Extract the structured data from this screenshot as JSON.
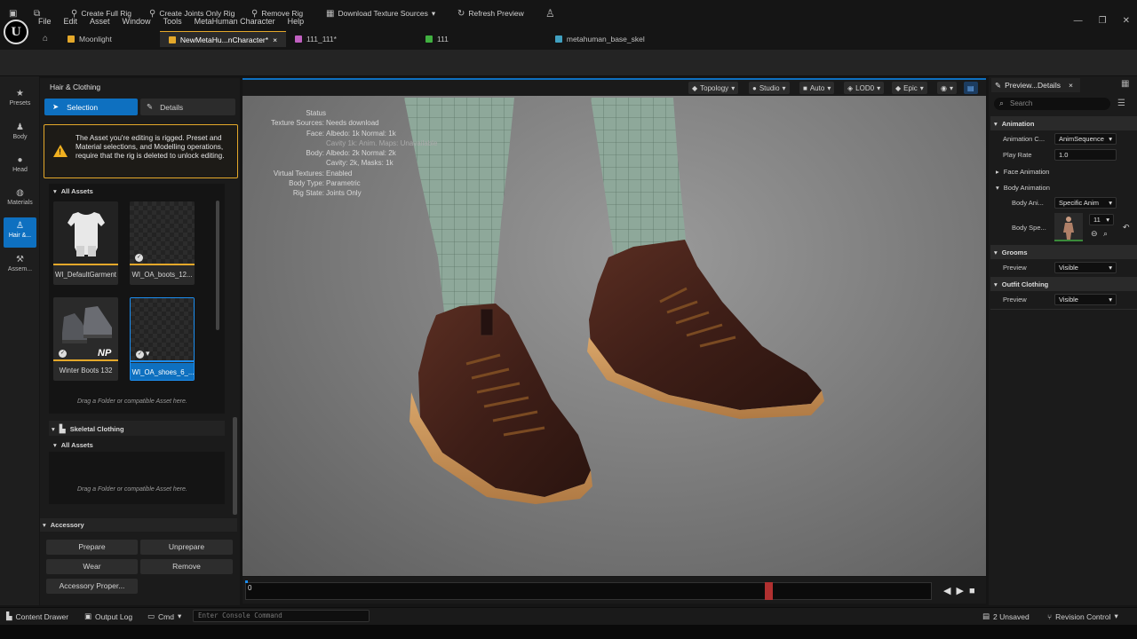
{
  "app": {
    "logo_text": "U",
    "menu": [
      "File",
      "Edit",
      "Asset",
      "Window",
      "Tools",
      "MetaHuman Character",
      "Help"
    ],
    "tabs": [
      {
        "label": "Moonlight",
        "icon": "level-icon",
        "color": "#e4a82a",
        "active": false
      },
      {
        "label": "NewMetaHu...nCharacter*",
        "icon": "character-icon",
        "color": "#e4a82a",
        "active": true
      },
      {
        "label": "111_111*",
        "icon": "skeleton-icon",
        "color": "#c060c0",
        "active": false
      },
      {
        "label": "111",
        "icon": "anim-icon",
        "color": "#40b040",
        "active": false
      },
      {
        "label": "metahuman_base_skel",
        "icon": "skeleton-icon",
        "color": "#40a0c0",
        "active": false
      }
    ]
  },
  "toolbar": {
    "create_full_rig": "Create Full Rig",
    "create_joints_only_rig": "Create Joints Only Rig",
    "remove_rig": "Remove Rig",
    "download_texture_sources": "Download Texture Sources",
    "refresh_preview": "Refresh Preview"
  },
  "rail": [
    {
      "label": "Presets",
      "icon": "star-icon",
      "glyph": "★"
    },
    {
      "label": "Body",
      "icon": "body-icon",
      "glyph": "♟"
    },
    {
      "label": "Head",
      "icon": "head-icon",
      "glyph": "●"
    },
    {
      "label": "Materials",
      "icon": "materials-icon",
      "glyph": "◍"
    },
    {
      "label": "Hair &...",
      "icon": "hair-icon",
      "glyph": "♙"
    },
    {
      "label": "Assem...",
      "icon": "hammer-icon",
      "glyph": "⚒"
    }
  ],
  "left_panel": {
    "title": "Hair & Clothing",
    "selection_label": "Selection",
    "details_label": "Details",
    "warning": "The Asset you're editing is rigged. Preset and Material selections, and Modelling operations, require that the rig is deleted to unlock editing.",
    "all_assets_label": "All Assets",
    "assets": [
      {
        "name": "WI_DefaultGarment"
      },
      {
        "name": "WI_OA_boots_12..."
      },
      {
        "name": "Winter Boots 132"
      },
      {
        "name": "WI_OA_shoes_6_..."
      }
    ],
    "np_badge": "NP",
    "drag_hint": "Drag a Folder or compatible Asset here.",
    "skeletal_clothing_label": "Skeletal Clothing",
    "skeletal_all_assets_label": "All Assets",
    "skeletal_drag_hint": "Drag a Folder or compatible Asset here.",
    "accessory_label": "Accessory",
    "prepare": "Prepare",
    "unprepare": "Unprepare",
    "wear": "Wear",
    "remove": "Remove",
    "accessory_properties": "Accessory Proper..."
  },
  "viewport": {
    "buttons": {
      "topology": "Topology",
      "studio": "Studio",
      "auto": "Auto",
      "lod": "LOD0",
      "quality": "Epic"
    },
    "status_title": "Status",
    "status": [
      {
        "k": "Texture Sources:",
        "v": "Needs download"
      },
      {
        "k": "Face:",
        "v": "Albedo: 1k Normal: 1k"
      },
      {
        "k": "",
        "v": "Cavity 1k: Anim. Maps: Unavailable"
      },
      {
        "k": "Body:",
        "v": "Albedo: 2k Normal: 2k"
      },
      {
        "k": "",
        "v": "Cavity: 2k, Masks: 1k"
      },
      {
        "k": "Virtual Textures:",
        "v": "Enabled"
      },
      {
        "k": "Body Type:",
        "v": "Parametric"
      },
      {
        "k": "Rig State:",
        "v": "Joints Only"
      }
    ]
  },
  "timeline": {
    "frame": "0",
    "marker_position": 0.757
  },
  "details": {
    "tab": "Preview...Details",
    "search_placeholder": "Search",
    "animation": "Animation",
    "animation_class_label": "Animation C...",
    "animation_class_value": "AnimSequence",
    "play_rate_label": "Play Rate",
    "play_rate_value": "1.0",
    "face_animation": "Face Animation",
    "body_animation": "Body Animation",
    "body_anim_label": "Body Ani...",
    "body_anim_value": "Specific Anim",
    "body_spec_label": "Body Spe...",
    "body_spec_value": "11",
    "grooms": "Grooms",
    "grooms_preview_label": "Preview",
    "grooms_preview_value": "Visible",
    "outfit_clothing": "Outfit Clothing",
    "outfit_preview_label": "Preview",
    "outfit_preview_value": "Visible"
  },
  "statusbar": {
    "content_drawer": "Content Drawer",
    "output_log": "Output Log",
    "cmd": "Cmd",
    "console_placeholder": "Enter Console Command",
    "unsaved": "2 Unsaved",
    "revision_control": "Revision Control"
  },
  "colors": {
    "accent_blue": "#0e70c0",
    "accent_orange": "#e4a82a",
    "timeline_marker": "#b03030"
  }
}
